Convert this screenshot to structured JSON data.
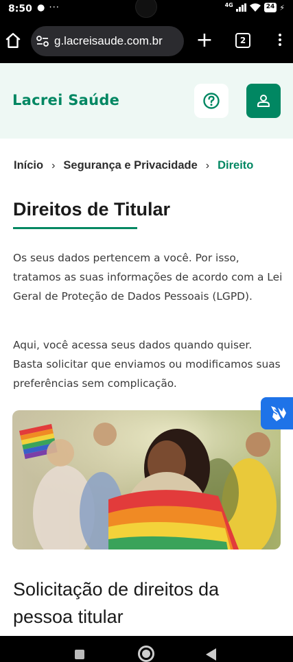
{
  "status_bar": {
    "time": "8:50",
    "left_icons": "● ···",
    "network": "4G",
    "battery": "24"
  },
  "browser": {
    "url": "g.lacreisaude.com.br",
    "tab_count": "2"
  },
  "header": {
    "logo": "Lacrei Saúde"
  },
  "breadcrumb": {
    "items": [
      "Início",
      "Segurança e Privacidade"
    ],
    "current": "Direito"
  },
  "main": {
    "title": "Direitos de Titular",
    "paragraph_1": "Os seus dados pertencem a você. Por isso, tratamos as suas informações de acordo com a Lei Geral de Proteção de Dados Pessoais (LGPD).",
    "paragraph_2": "Aqui, você acessa seus dados quando quiser. Basta solicitar que enviamos ou modificamos suas preferências sem complicação.",
    "section_title": "Solicitação de direitos da pessoa titular"
  },
  "colors": {
    "brand_green": "#018762",
    "header_bg": "#eef8f4",
    "accessibility_blue": "#1e73e8"
  },
  "icons": {
    "help": "help-circle-icon",
    "user": "user-icon",
    "accessibility": "sign-language-hands-icon"
  }
}
